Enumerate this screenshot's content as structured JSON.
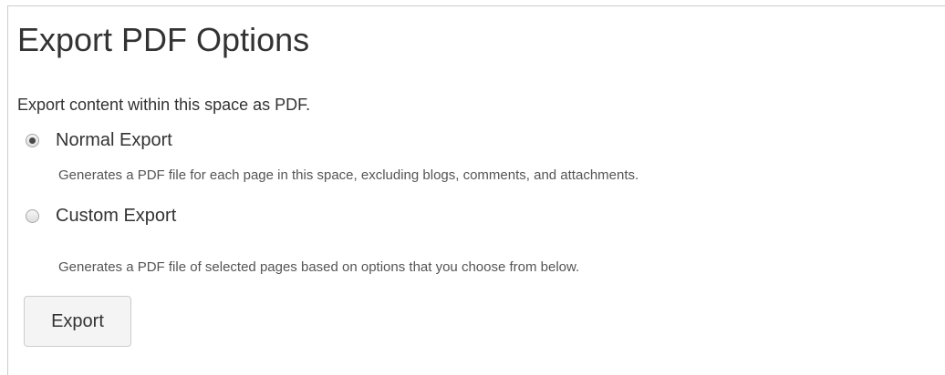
{
  "page": {
    "title": "Export PDF Options",
    "intro": "Export content within this space as PDF."
  },
  "options": {
    "normal": {
      "label": "Normal Export",
      "description": "Generates a PDF file for each page in this space, excluding blogs, comments, and attachments.",
      "selected": true
    },
    "custom": {
      "label": "Custom Export",
      "description": "Generates a PDF file of selected pages based on options that you choose from below.",
      "selected": false
    }
  },
  "actions": {
    "export_label": "Export"
  }
}
